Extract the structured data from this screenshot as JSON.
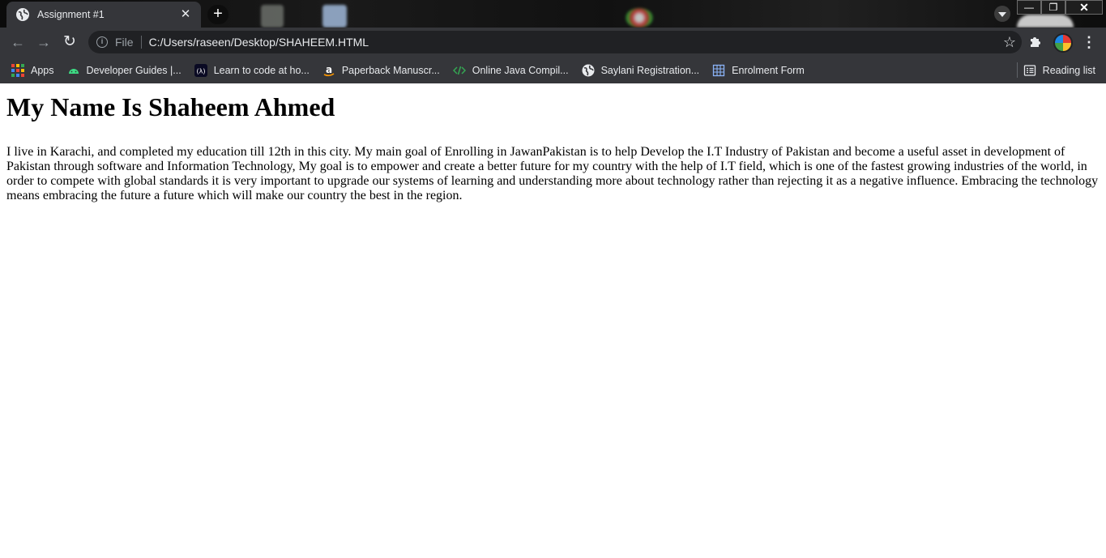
{
  "browser": {
    "tab": {
      "title": "Assignment #1",
      "close": "✕"
    },
    "new_tab": "+",
    "address_bar": {
      "scheme": "File",
      "url": "C:/Users/raseen/Desktop/SHAHEEM.HTML"
    },
    "window_controls": {
      "minimize": "—",
      "restore": "❐",
      "close": "✕"
    },
    "icons": {
      "back": "back-arrow-icon",
      "forward": "forward-arrow-icon",
      "reload": "reload-icon",
      "info": "info-icon",
      "star": "star-icon",
      "extensions": "puzzle-icon",
      "menu": "kebab-menu-icon",
      "tab_search": "tab-search-icon"
    },
    "bookmarks": [
      {
        "label": "Apps",
        "icon": "apps-grid-icon"
      },
      {
        "label": "Developer Guides  |...",
        "icon": "android-icon"
      },
      {
        "label": "Learn to code at ho...",
        "icon": "freecodecamp-icon"
      },
      {
        "label": "Paperback Manuscr...",
        "icon": "amazon-icon"
      },
      {
        "label": "Online Java Compil...",
        "icon": "code-icon"
      },
      {
        "label": "Saylani Registration...",
        "icon": "globe-icon"
      },
      {
        "label": "Enrolment Form",
        "icon": "form-grid-icon"
      }
    ],
    "reading_list": "Reading list",
    "colors": {
      "chrome_dark": "#35363a",
      "omnibox": "#202124",
      "text": "#e8eaed"
    }
  },
  "page": {
    "heading": "My Name Is Shaheem Ahmed",
    "paragraph": "I live in Karachi, and completed my education till 12th in this city. My main goal of Enrolling in JawanPakistan is to help Develop the I.T Industry of Pakistan and become a useful asset in development of Pakistan through software and Information Technology, My goal is to empower and create a better future for my country with the help of I.T field, which is one of the fastest growing industries of the world, in order to compete with global standards it is very important to upgrade our systems of learning and understanding more about technology rather than rejecting it as a negative influence. Embracing the technology means embracing the future a future which will make our country the best in the region."
  }
}
